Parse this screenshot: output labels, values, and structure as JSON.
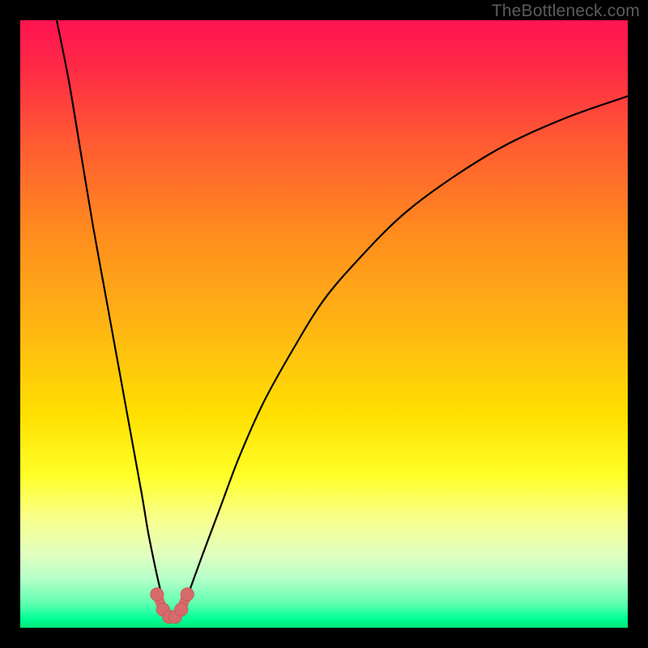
{
  "watermark": "TheBottleneck.com",
  "colors": {
    "frame_bg": "#000000",
    "curve_stroke": "#000000",
    "marker_fill": "#d76a6a",
    "marker_stroke": "#c65a5a",
    "gradient_stops": [
      {
        "offset": 0.0,
        "color": "#ff1450"
      },
      {
        "offset": 0.08,
        "color": "#ff2a46"
      },
      {
        "offset": 0.2,
        "color": "#ff5a32"
      },
      {
        "offset": 0.35,
        "color": "#ff8c1e"
      },
      {
        "offset": 0.5,
        "color": "#ffb414"
      },
      {
        "offset": 0.65,
        "color": "#ffe000"
      },
      {
        "offset": 0.75,
        "color": "#ffff28"
      },
      {
        "offset": 0.82,
        "color": "#f8ff8c"
      },
      {
        "offset": 0.88,
        "color": "#e0ffc0"
      },
      {
        "offset": 0.92,
        "color": "#b4ffc8"
      },
      {
        "offset": 0.96,
        "color": "#60ffb0"
      },
      {
        "offset": 0.985,
        "color": "#00ff96"
      },
      {
        "offset": 1.0,
        "color": "#00e878"
      }
    ]
  },
  "chart_data": {
    "type": "line",
    "title": "",
    "xlabel": "",
    "ylabel": "",
    "xlim": [
      0,
      100
    ],
    "ylim": [
      0,
      100
    ],
    "x_optimum": 25,
    "series": [
      {
        "name": "left-curve",
        "x": [
          6,
          8,
          10,
          12,
          14,
          16,
          18,
          20,
          21,
          22,
          23,
          24,
          25
        ],
        "y": [
          100,
          90,
          78,
          66,
          55,
          44,
          33,
          22,
          16,
          11,
          6.5,
          3,
          1.5
        ]
      },
      {
        "name": "right-curve",
        "x": [
          25,
          26,
          27,
          28,
          30,
          33,
          36,
          40,
          45,
          50,
          56,
          63,
          71,
          80,
          90,
          100
        ],
        "y": [
          1.5,
          2.2,
          4,
          6.5,
          12,
          20,
          28,
          37,
          46,
          54,
          61,
          68,
          74,
          79.5,
          84,
          87.5
        ]
      }
    ],
    "markers": {
      "name": "optimum-band",
      "x": [
        22.5,
        23.5,
        24.5,
        25.5,
        26.5,
        27.5
      ],
      "y": [
        5.5,
        3.0,
        1.8,
        1.8,
        3.0,
        5.5
      ]
    }
  }
}
